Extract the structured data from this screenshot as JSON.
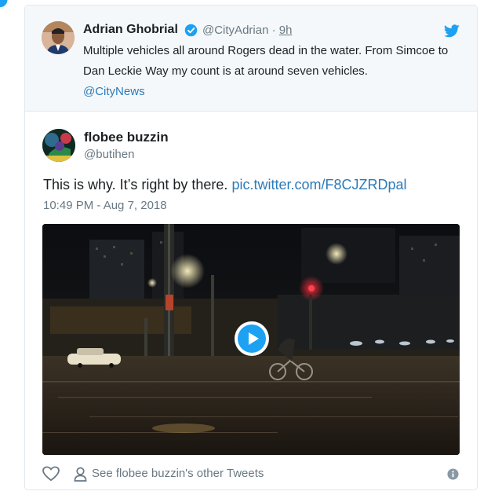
{
  "quoted": {
    "name": "Adrian Ghobrial",
    "handle": "@CityAdrian",
    "separator": "·",
    "time": "9h",
    "text": "Multiple vehicles all around Rogers dead in the water. From Simcoe to Dan Leckie Way my count is at around seven vehicles.",
    "mention": "@CityNews"
  },
  "tweet": {
    "name": "flobee buzzin",
    "handle": "@butihen",
    "text": "This is why. It’s right by there.",
    "link": "pic.twitter.com/F8CJZRDpal",
    "timestamp": "10:49 PM - Aug 7, 2018"
  },
  "footer": {
    "other_tweets": "See flobee buzzin's other Tweets"
  },
  "icons": {
    "brand": "twitter-bird-icon",
    "verified": "verified-badge-icon",
    "like": "heart-icon",
    "person": "person-icon",
    "info": "info-icon",
    "play": "play-icon"
  },
  "colors": {
    "brand_blue": "#1da1f2",
    "link_blue": "#2b7bb9",
    "muted_gray": "#697882",
    "quoted_bg": "#f5f8fa",
    "border": "#e1e8ed"
  }
}
